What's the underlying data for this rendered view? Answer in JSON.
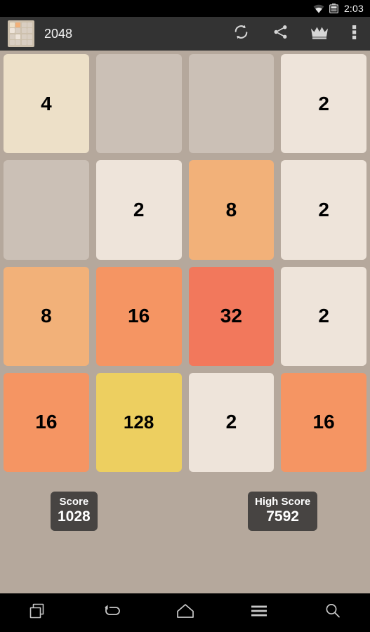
{
  "status_bar": {
    "time": "2:03",
    "icons": [
      {
        "name": "wifi-icon"
      },
      {
        "name": "battery-icon"
      }
    ]
  },
  "toolbar": {
    "app_title": "2048",
    "app_icon_name": "app-icon-2048-board",
    "app_icon_cells": [
      "c4",
      "c8",
      "empty",
      "empty",
      "c2",
      "empty",
      "empty",
      "empty",
      "empty",
      "c2",
      "empty",
      "empty",
      "empty",
      "empty",
      "empty",
      "empty"
    ],
    "actions": [
      {
        "name": "restart-button",
        "icon": "refresh-icon",
        "label": "Restart"
      },
      {
        "name": "share-button",
        "icon": "share-icon",
        "label": "Share"
      },
      {
        "name": "leaderboard-button",
        "icon": "crown-icon",
        "label": "Leaderboard"
      },
      {
        "name": "overflow-menu-button",
        "icon": "more-vertical-icon",
        "label": "More options"
      }
    ]
  },
  "board": {
    "rows": 4,
    "cols": 4,
    "cells": [
      {
        "value": 4,
        "text": "4"
      },
      {
        "value": 0,
        "text": ""
      },
      {
        "value": 0,
        "text": ""
      },
      {
        "value": 2,
        "text": "2"
      },
      {
        "value": 0,
        "text": ""
      },
      {
        "value": 2,
        "text": "2"
      },
      {
        "value": 8,
        "text": "8"
      },
      {
        "value": 2,
        "text": "2"
      },
      {
        "value": 8,
        "text": "8"
      },
      {
        "value": 16,
        "text": "16"
      },
      {
        "value": 32,
        "text": "32"
      },
      {
        "value": 2,
        "text": "2"
      },
      {
        "value": 16,
        "text": "16"
      },
      {
        "value": 128,
        "text": "128"
      },
      {
        "value": 2,
        "text": "2"
      },
      {
        "value": 16,
        "text": "16"
      }
    ]
  },
  "scores": {
    "score_label": "Score",
    "score_value": "1028",
    "high_score_label": "High Score",
    "high_score_value": "7592"
  },
  "nav_bar": {
    "buttons": [
      {
        "name": "recents-button",
        "icon": "recents-icon",
        "label": "Recent apps"
      },
      {
        "name": "back-button",
        "icon": "back-arrow-icon",
        "label": "Back"
      },
      {
        "name": "home-button",
        "icon": "home-icon",
        "label": "Home"
      },
      {
        "name": "menu-button",
        "icon": "hamburger-menu-icon",
        "label": "Menu"
      },
      {
        "name": "search-button",
        "icon": "search-icon",
        "label": "Search"
      }
    ]
  },
  "colors": {
    "page_background": "#b5a89c",
    "empty_cell": "#cbc0b6",
    "toolbar": "#333333",
    "status_bar": "#000000",
    "nav_bar": "#000000",
    "score_box": "#474442",
    "tile_2": "#eee4da",
    "tile_4": "#ede0c8",
    "tile_8": "#f2b179",
    "tile_16": "#f59563",
    "tile_32": "#f2785c",
    "tile_128": "#edcf60",
    "tile_text": "#000000"
  }
}
